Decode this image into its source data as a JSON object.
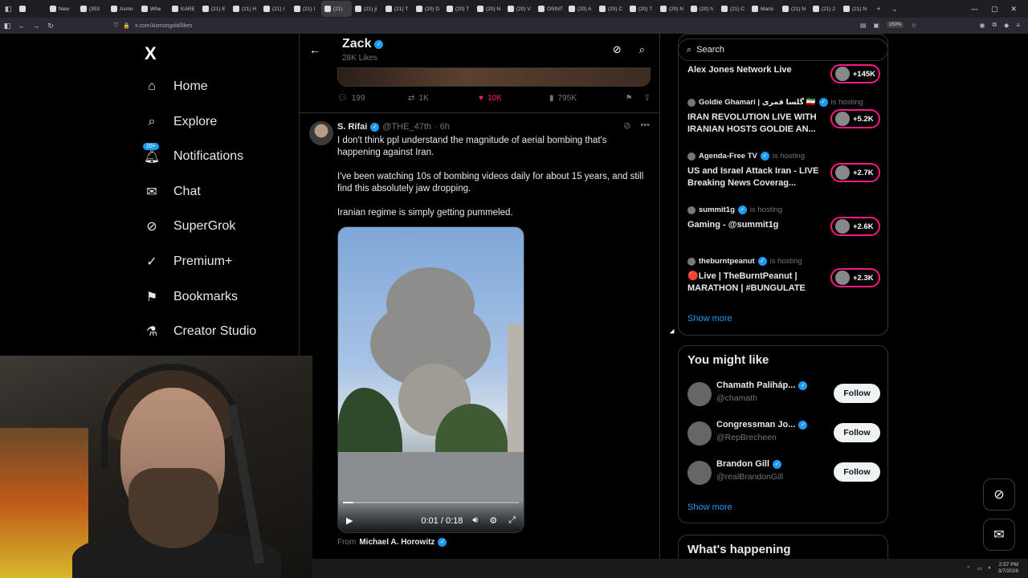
{
  "browser": {
    "tabs": [
      {
        "label": "",
        "active": false
      },
      {
        "label": "New",
        "active": false
      },
      {
        "label": "(353",
        "active": false
      },
      {
        "label": "Asmo",
        "active": false
      },
      {
        "label": "Whe",
        "active": false
      },
      {
        "label": "KARE",
        "active": false
      },
      {
        "label": "(21) E",
        "active": false
      },
      {
        "label": "(21) H",
        "active": false
      },
      {
        "label": "(21) I",
        "active": false
      },
      {
        "label": "(21) I",
        "active": false
      },
      {
        "label": "(21)",
        "active": true
      },
      {
        "label": "(21) ji",
        "active": false
      },
      {
        "label": "(21) T",
        "active": false
      },
      {
        "label": "(20) D",
        "active": false
      },
      {
        "label": "(20) T",
        "active": false
      },
      {
        "label": "(20) N",
        "active": false
      },
      {
        "label": "(20) V",
        "active": false
      },
      {
        "label": "OSINT",
        "active": false
      },
      {
        "label": "(20) A",
        "active": false
      },
      {
        "label": "(20) C",
        "active": false
      },
      {
        "label": "(20) T",
        "active": false
      },
      {
        "label": "(20) N",
        "active": false
      },
      {
        "label": "(20) h",
        "active": false
      },
      {
        "label": "(21) C",
        "active": false
      },
      {
        "label": "Mario",
        "active": false
      },
      {
        "label": "(21) N",
        "active": false
      },
      {
        "label": "(21) 2",
        "active": false
      },
      {
        "label": "(21) N",
        "active": false
      }
    ],
    "url": "x.com/Asmongold/likes",
    "zoom": "150%"
  },
  "nav": {
    "logo": "X",
    "items": [
      {
        "label": "Home",
        "icon": "home-icon"
      },
      {
        "label": "Explore",
        "icon": "search-icon"
      },
      {
        "label": "Notifications",
        "icon": "bell-icon",
        "badge": "20+"
      },
      {
        "label": "Chat",
        "icon": "mail-icon"
      },
      {
        "label": "SuperGrok",
        "icon": "grok-icon"
      },
      {
        "label": "Premium+",
        "icon": "verified-check-icon"
      },
      {
        "label": "Bookmarks",
        "icon": "bookmark-icon"
      },
      {
        "label": "Creator Studio",
        "icon": "flask-icon"
      }
    ]
  },
  "header": {
    "name": "Zack",
    "sub": "28K Likes"
  },
  "prev_tweet": {
    "replies": "199",
    "reposts": "1K",
    "likes": "10K",
    "views": "795K"
  },
  "tweet": {
    "name": "S. Rifai",
    "handle": "@THE_47th",
    "time": "· 6h",
    "text1": "I don't think ppl understand the magnitude of aerial bombing that's happening against Iran.",
    "text2": "I've been watching 10s of bombing videos daily for about 15 years, and still find this absolutely jaw dropping.",
    "text3": "Iranian regime is simply getting pummeled.",
    "video_time": "0:01 / 0:18",
    "video_progress": 0.06,
    "from_label": "From",
    "from_name": "Michael A. Horowitz"
  },
  "right": {
    "search_placeholder": "Search",
    "live_top": {
      "title": "Alex Jones Network Live",
      "count": "+145K"
    },
    "live": [
      {
        "host": "Goldie Ghamari | گلسا قمری 🇮🇷",
        "status": "is hosting",
        "title": "IRAN REVOLUTION LIVE WITH IRANIAN HOSTS GOLDIE AN...",
        "count": "+5.2K"
      },
      {
        "host": "Agenda-Free TV",
        "status": "is hosting",
        "title": "US and Israel Attack Iran - LIVE Breaking News Coverag...",
        "count": "+2.7K"
      },
      {
        "host": "summit1g",
        "status": "is hosting",
        "title": "Gaming - @summit1g",
        "count": "+2.6K"
      },
      {
        "host": "theburntpeanut",
        "status": "is hosting",
        "title": "🔴Live | TheBurntPeanut | MARATHON | #BUNGULATE",
        "count": "+2.3K"
      }
    ],
    "show_more": "Show more",
    "you_might_like": "You might like",
    "follow": [
      {
        "name": "Chamath Paliháp...",
        "handle": "@chamath",
        "button": "Follow"
      },
      {
        "name": "Congressman Jo...",
        "handle": "@RepBrecheen",
        "button": "Follow"
      },
      {
        "name": "Brandon Gill",
        "handle": "@realBrandonGill",
        "button": "Follow"
      }
    ],
    "show_more_2": "Show more",
    "whats_happening": "What's happening"
  },
  "taskbar": {
    "time": "2:57 PM",
    "date": "3/7/2026"
  },
  "colors": {
    "accent": "#1d9bf0",
    "like": "#f91880",
    "background": "#000000"
  }
}
